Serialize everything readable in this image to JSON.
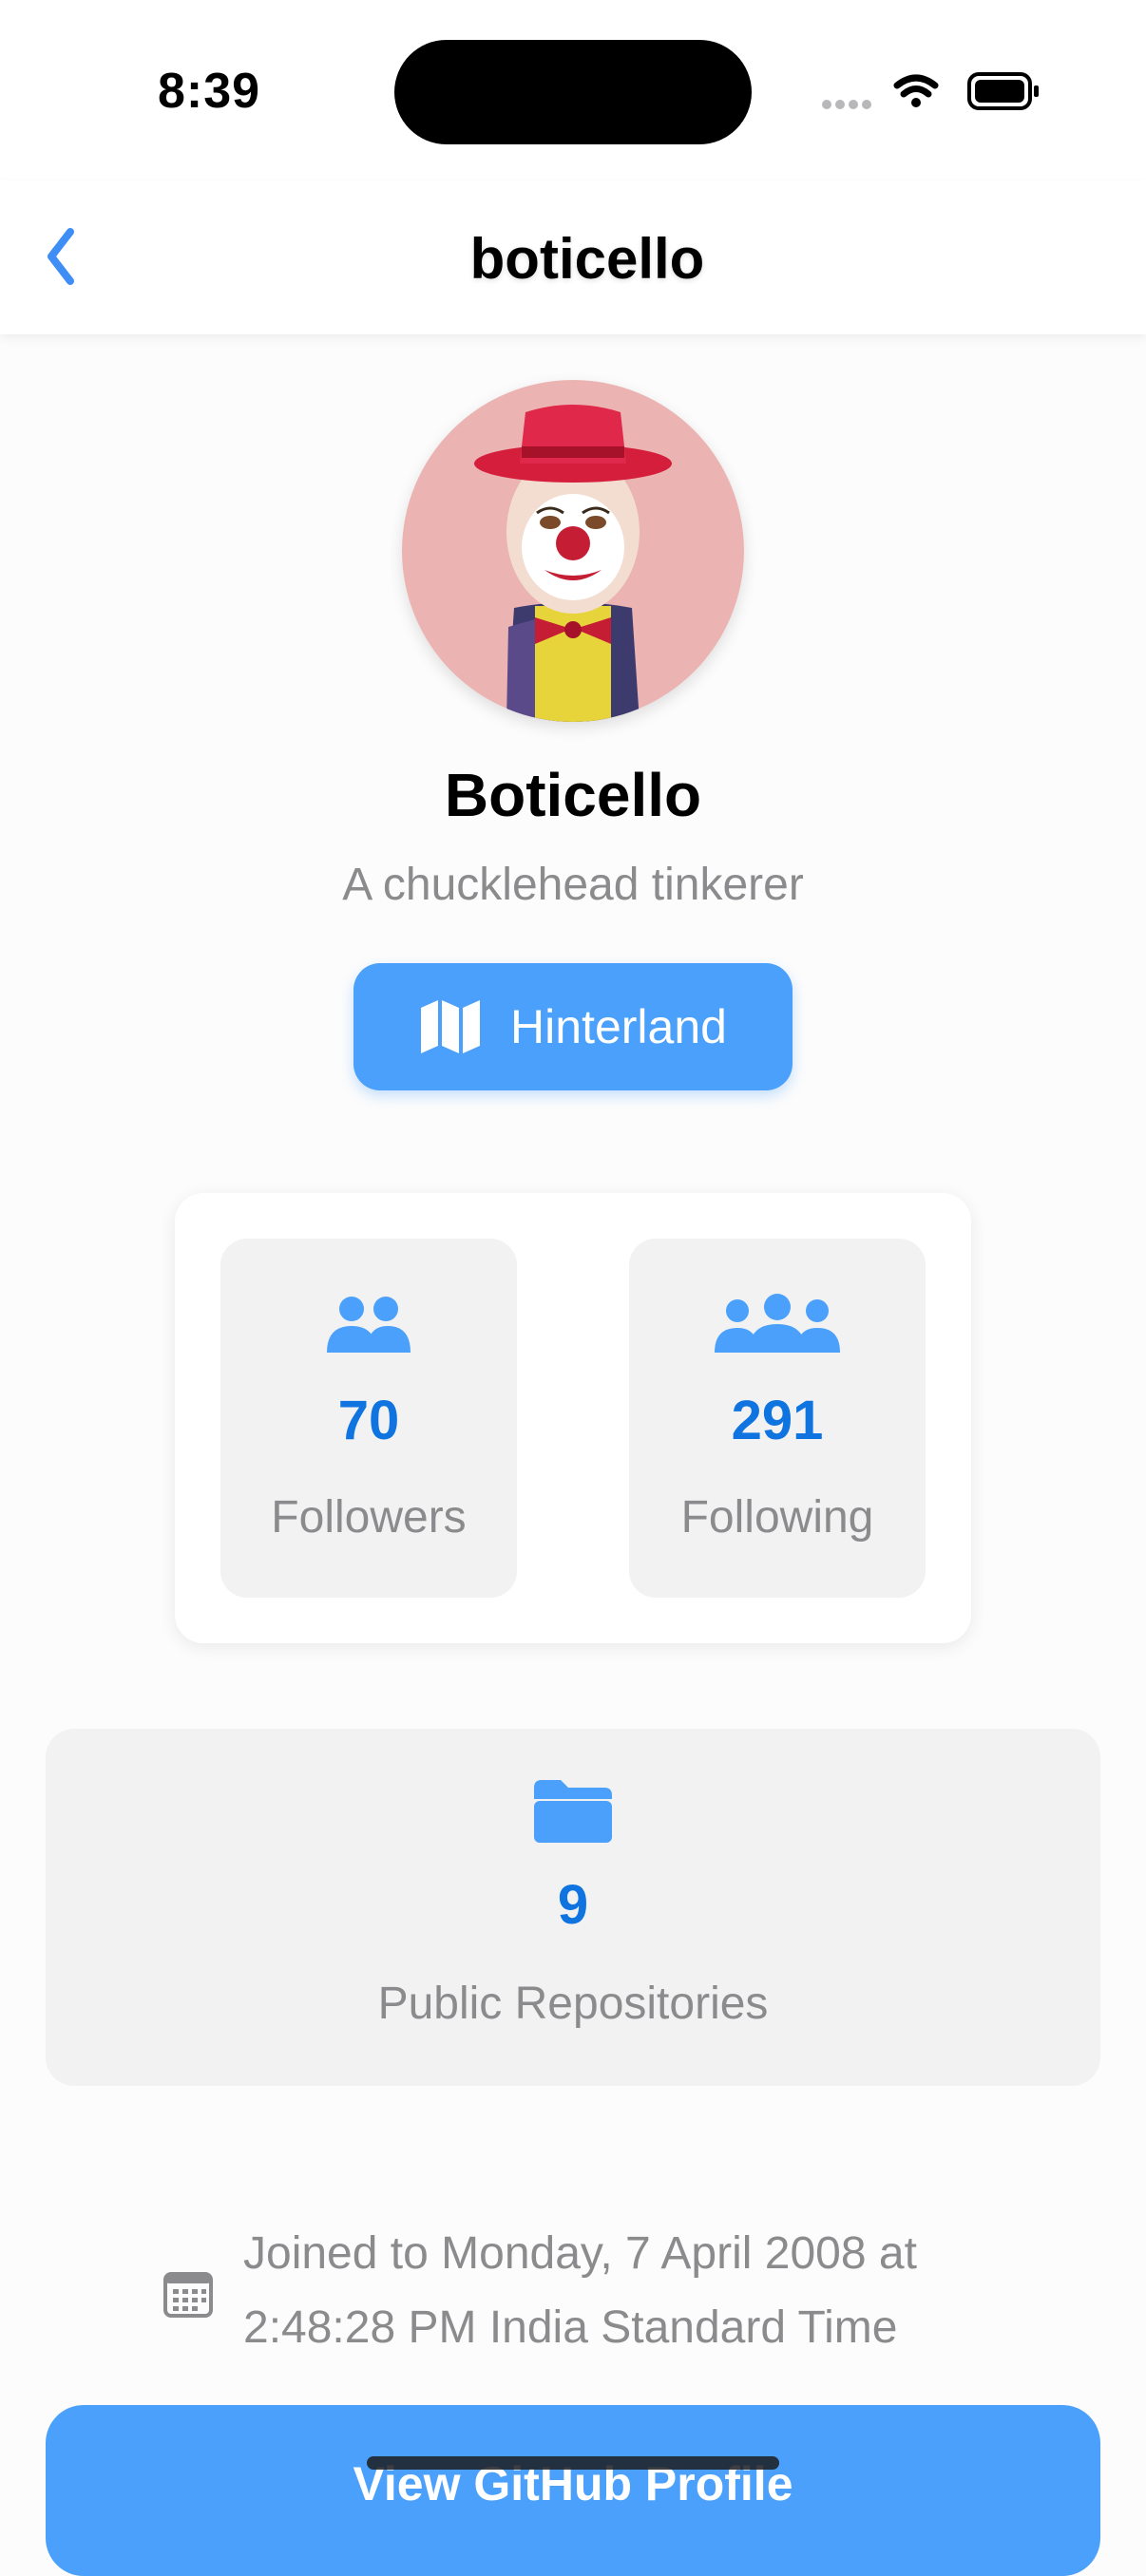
{
  "status_bar": {
    "time": "8:39",
    "icons": [
      "cellular-signal-icon",
      "wifi-icon",
      "battery-icon"
    ]
  },
  "nav": {
    "title": "boticello",
    "back_icon": "chevron-left-icon"
  },
  "profile": {
    "avatar": "clown-figurine-avatar",
    "name": "Boticello",
    "bio": "A chucklehead tinkerer",
    "location": "Hinterland",
    "location_icon": "map-icon"
  },
  "stats": {
    "followers": {
      "value": "70",
      "label": "Followers",
      "icon": "two-people-icon"
    },
    "following": {
      "value": "291",
      "label": "Following",
      "icon": "three-people-icon"
    }
  },
  "repos": {
    "value": "9",
    "label": "Public Repositories",
    "icon": "folder-icon"
  },
  "joined": {
    "line1": "Joined to Monday, 7 April 2008 at",
    "line2": "2:48:28 PM India Standard Time",
    "icon": "calendar-icon"
  },
  "cta": {
    "label": "View GitHub Profile"
  },
  "colors": {
    "accent": "#4aa0fb",
    "value_blue": "#0f74e0",
    "secondary_text": "#8b8b8e",
    "tile_bg": "#f2f2f3"
  }
}
